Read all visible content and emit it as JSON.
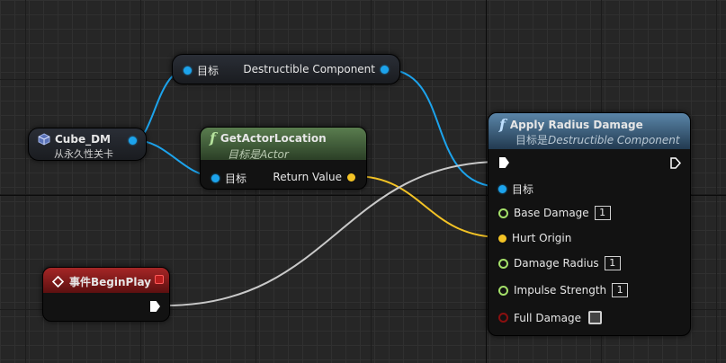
{
  "nodes": {
    "destructible_var": {
      "target_label": "目标",
      "output_label": "Destructible Component"
    },
    "cube_dm": {
      "title": "Cube_DM",
      "subtitle": "从永久性关卡"
    },
    "get_actor_location": {
      "title": "GetActorLocation",
      "subtitle": "目标是Actor",
      "target_label": "目标",
      "return_label": "Return Value"
    },
    "begin_play": {
      "title": "事件BeginPlay"
    },
    "apply_radius_damage": {
      "title": "Apply Radius Damage",
      "subtitle_prefix": "目标是",
      "subtitle_target": "Destructible Component",
      "pins": [
        {
          "label": "目标",
          "value": ""
        },
        {
          "label": "Base Damage",
          "value": "1"
        },
        {
          "label": "Hurt Origin",
          "value": ""
        },
        {
          "label": "Damage Radius",
          "value": "1"
        },
        {
          "label": "Impulse Strength",
          "value": "1"
        },
        {
          "label": "Full Damage",
          "value": ""
        }
      ]
    }
  },
  "colors": {
    "object_pin": "#1ca3ec",
    "vector_pin": "#f3c325",
    "float_pin": "#a4e069",
    "bool_pin": "#8a0f0f",
    "event_header": "#8b1a1a",
    "function_header": "#3e5a36",
    "apply_header": "#355a78"
  },
  "icons": [
    "function-icon",
    "event-diamond-icon",
    "component-cube-icon",
    "exec-pin-icon"
  ]
}
